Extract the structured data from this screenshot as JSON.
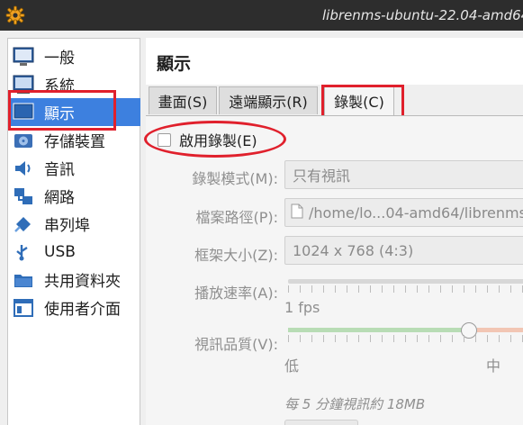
{
  "window": {
    "title": "librenms-ubuntu-22.04-amd64 -",
    "app_icon": "gear-icon"
  },
  "sidebar": {
    "items": [
      {
        "label": "一般",
        "icon": "general-icon"
      },
      {
        "label": "系統",
        "icon": "system-icon"
      },
      {
        "label": "顯示",
        "icon": "display-icon"
      },
      {
        "label": "存儲裝置",
        "icon": "storage-icon"
      },
      {
        "label": "音訊",
        "icon": "audio-icon"
      },
      {
        "label": "網路",
        "icon": "network-icon"
      },
      {
        "label": "串列埠",
        "icon": "serial-port-icon"
      },
      {
        "label": "USB",
        "icon": "usb-icon"
      },
      {
        "label": "共用資料夾",
        "icon": "shared-folder-icon"
      },
      {
        "label": "使用者介面",
        "icon": "user-interface-icon"
      }
    ],
    "selected": "顯示"
  },
  "page": {
    "title": "顯示"
  },
  "tabs": [
    {
      "label": "畫面(S)"
    },
    {
      "label": "遠端顯示(R)"
    },
    {
      "label": "錄製(C)"
    }
  ],
  "recording": {
    "enable_label": "啟用錄製(E)",
    "enabled": false,
    "mode_label": "錄製模式(M):",
    "mode_value": "只有視訊",
    "path_label": "檔案路徑(P):",
    "path_value": "/home/lo...04-amd64/librenms",
    "frame_size_label": "框架大小(Z):",
    "frame_size_value": "1024 x 768 (4:3)",
    "frame_rate_label": "播放速率(A):",
    "frame_rate_value": "1 fps",
    "frame_rate_fraction": 0,
    "quality_label": "視訊品質(V):",
    "quality_low": "低",
    "quality_medium": "中",
    "quality_fraction": 0.77,
    "estimate": "每 5 分鐘視訊約 18MB"
  },
  "colors": {
    "selection": "#3d80df",
    "annotation_red": "#e0202c",
    "titlebar": "#2d2d2d"
  }
}
